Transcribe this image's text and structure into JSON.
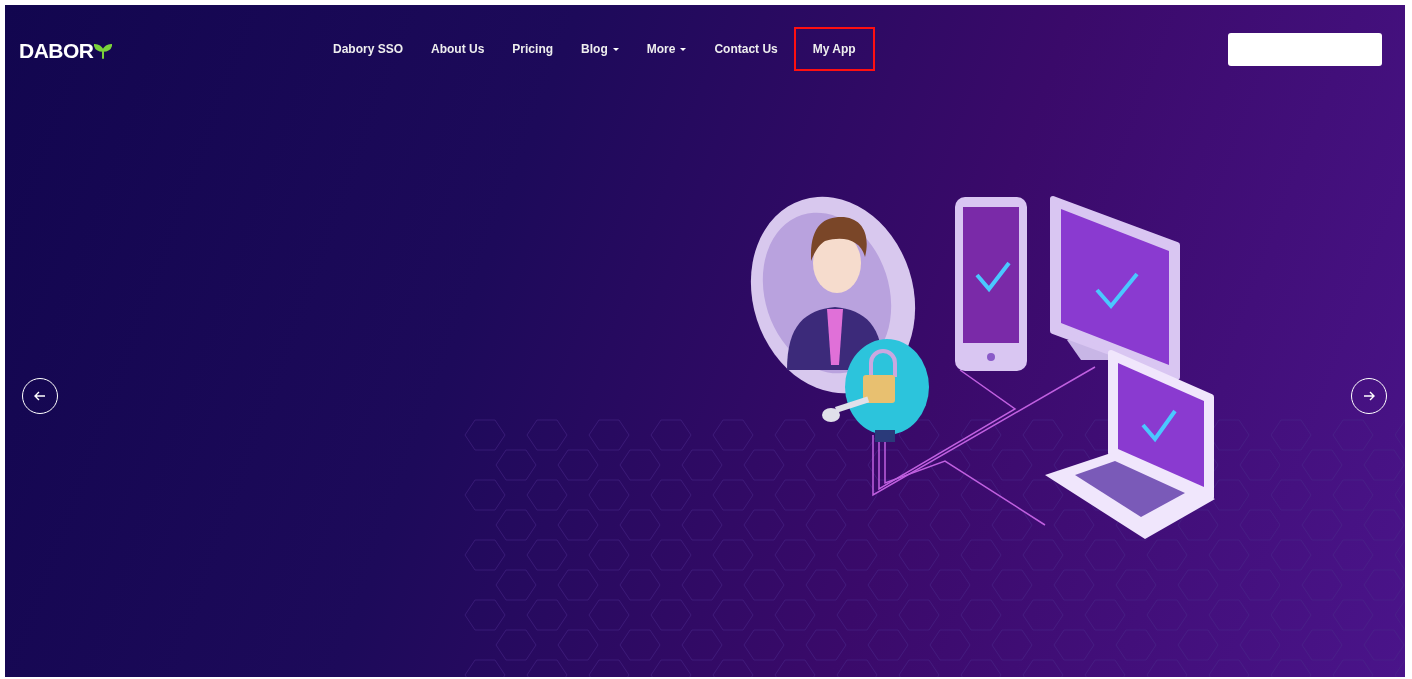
{
  "logo": {
    "text": "DABOR"
  },
  "nav": [
    {
      "label": "Dabory SSO",
      "dropdown": false,
      "highlighted": false
    },
    {
      "label": "About Us",
      "dropdown": false,
      "highlighted": false
    },
    {
      "label": "Pricing",
      "dropdown": false,
      "highlighted": false
    },
    {
      "label": "Blog",
      "dropdown": true,
      "highlighted": false
    },
    {
      "label": "More",
      "dropdown": true,
      "highlighted": false
    },
    {
      "label": "Contact Us",
      "dropdown": false,
      "highlighted": false
    },
    {
      "label": "My App",
      "dropdown": false,
      "highlighted": true
    }
  ]
}
